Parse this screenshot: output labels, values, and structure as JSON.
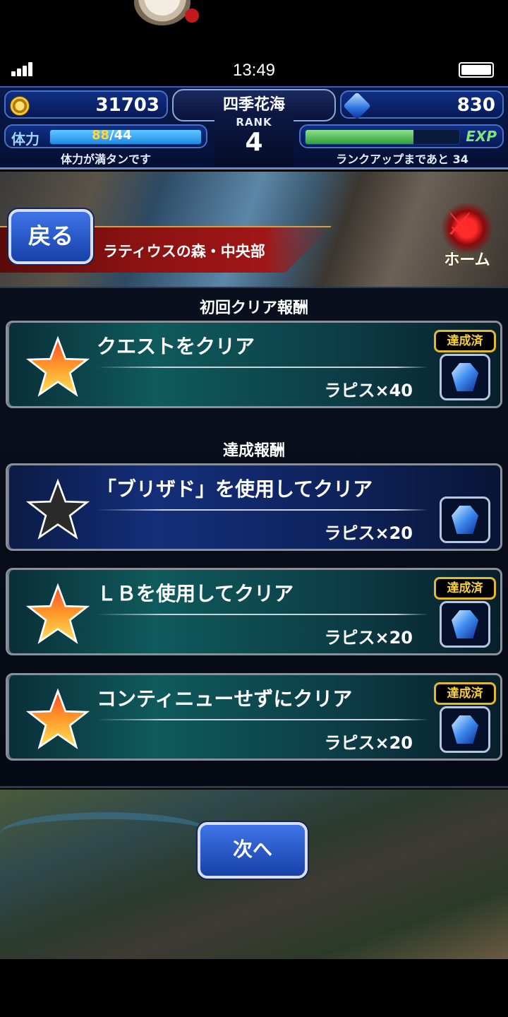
{
  "status_bar": {
    "time": "13:49"
  },
  "hud": {
    "gil": "31703",
    "player_name": "四季花海",
    "rank_label": "RANK",
    "rank": "4",
    "lapis": "830",
    "stamina_label": "体力",
    "stamina_current": "88",
    "stamina_max": "/44",
    "stamina_status": "体力が満タンです",
    "exp_label": "EXP",
    "exp_progress": 0.7,
    "exp_status": "ランクアップまであと 34"
  },
  "nav": {
    "back_label": "戻る",
    "quest_title": "ラティウスの森・中央部",
    "home_label": "ホーム"
  },
  "first_clear": {
    "section_title": "初回クリア報酬",
    "items": [
      {
        "label": "クエストをクリア",
        "reward": "ラピス×40",
        "completed": true,
        "badge": "達成済"
      }
    ]
  },
  "missions": {
    "section_title": "達成報酬",
    "items": [
      {
        "label": "「ブリザド」を使用してクリア",
        "reward": "ラピス×20",
        "completed": false,
        "badge": ""
      },
      {
        "label": "ＬＢを使用してクリア",
        "reward": "ラピス×20",
        "completed": true,
        "badge": "達成済"
      },
      {
        "label": "コンティニューせずにクリア",
        "reward": "ラピス×20",
        "completed": true,
        "badge": "達成済"
      }
    ]
  },
  "footer": {
    "next_label": "次へ"
  },
  "colors": {
    "accent_blue": "#1740a8",
    "badge_gold": "#e3b92a",
    "stamina_value": "#ffd640"
  },
  "icons": [
    "signal-icon",
    "battery-icon",
    "gil-coin-icon",
    "lapis-gem-icon",
    "home-swords-icon",
    "star-icon"
  ]
}
